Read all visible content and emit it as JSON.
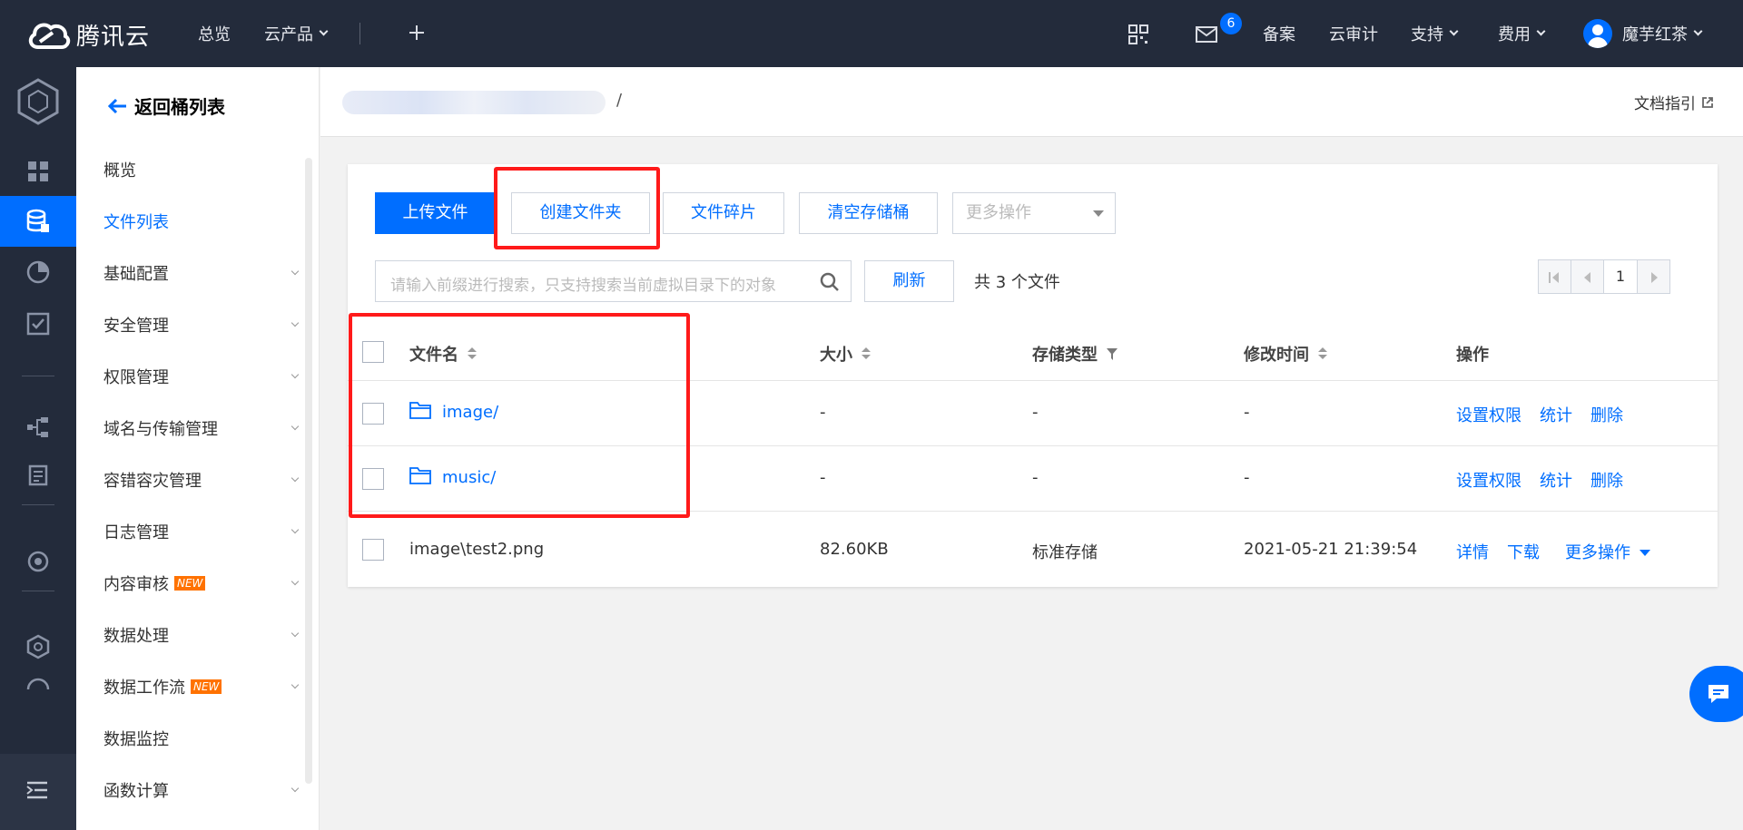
{
  "brand": {
    "name": "腾讯云"
  },
  "topnav": {
    "overview": "总览",
    "products": "云产品",
    "mail_badge": "6",
    "beian": "备案",
    "audit": "云审计",
    "support": "支持",
    "billing": "费用",
    "user": "魔芋红茶"
  },
  "sidebar": {
    "back_label": "返回桶列表",
    "items": [
      {
        "label": "概览",
        "expandable": false
      },
      {
        "label": "文件列表",
        "expandable": false,
        "active": true
      },
      {
        "label": "基础配置",
        "expandable": true
      },
      {
        "label": "安全管理",
        "expandable": true
      },
      {
        "label": "权限管理",
        "expandable": true
      },
      {
        "label": "域名与传输管理",
        "expandable": true
      },
      {
        "label": "容错容灾管理",
        "expandable": true
      },
      {
        "label": "日志管理",
        "expandable": true
      },
      {
        "label": "内容审核",
        "expandable": true,
        "tag": "NEW"
      },
      {
        "label": "数据处理",
        "expandable": true
      },
      {
        "label": "数据工作流",
        "expandable": true,
        "tag": "NEW"
      },
      {
        "label": "数据监控",
        "expandable": false
      },
      {
        "label": "函数计算",
        "expandable": true
      }
    ]
  },
  "header": {
    "path_separator": "/",
    "doc_guide": "文档指引"
  },
  "toolbar": {
    "upload": "上传文件",
    "create_folder": "创建文件夹",
    "fragments": "文件碎片",
    "clear_bucket": "清空存储桶",
    "more_ops": "更多操作",
    "search_placeholder": "请输入前缀进行搜索，只支持搜索当前虚拟目录下的对象",
    "refresh": "刷新",
    "count": "共 3 个文件",
    "page": "1"
  },
  "table": {
    "columns": [
      "文件名",
      "大小",
      "存储类型",
      "修改时间",
      "操作"
    ],
    "rows": [
      {
        "name": "image/",
        "size": "-",
        "storage": "-",
        "modified": "-",
        "actions": [
          "设置权限",
          "统计",
          "删除"
        ],
        "is_folder": true
      },
      {
        "name": "music/",
        "size": "-",
        "storage": "-",
        "modified": "-",
        "actions": [
          "设置权限",
          "统计",
          "删除"
        ],
        "is_folder": true
      },
      {
        "name": "image\\test2.png",
        "size": "82.60KB",
        "storage": "标准存储",
        "modified": "2021-05-21 21:39:54",
        "actions": [
          "详情",
          "下载",
          "更多操作"
        ],
        "is_folder": false
      }
    ]
  },
  "colors": {
    "accent": "#006eff",
    "topbar": "#232b3b",
    "highlight": "#ff1a1a",
    "new_tag": "#ff7200"
  }
}
